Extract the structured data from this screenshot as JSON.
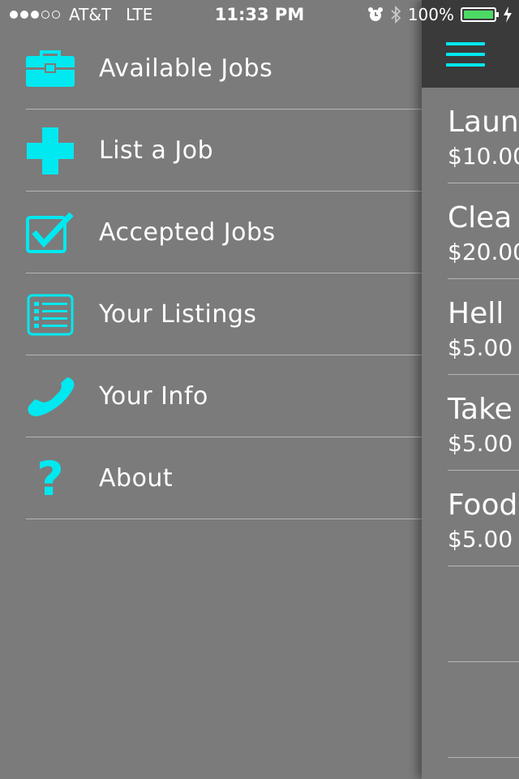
{
  "status_bar": {
    "carrier": "AT&T",
    "network": "LTE",
    "time": "11:33 PM",
    "battery_percent": "100%",
    "signal_bars": 3
  },
  "menu": {
    "items": [
      {
        "label": "Available Jobs",
        "icon": "briefcase-icon"
      },
      {
        "label": "List a Job",
        "icon": "plus-icon"
      },
      {
        "label": "Accepted Jobs",
        "icon": "checkbox-icon"
      },
      {
        "label": "Your Listings",
        "icon": "list-icon"
      },
      {
        "label": "Your Info",
        "icon": "phone-icon"
      },
      {
        "label": "About",
        "icon": "question-icon"
      }
    ]
  },
  "jobs": [
    {
      "title": "Laun",
      "price": "$10.00"
    },
    {
      "title": "Clea",
      "price": "$20.00"
    },
    {
      "title": "Hell",
      "price": "$5.00"
    },
    {
      "title": "Take",
      "price": "$5.00"
    },
    {
      "title": "Food",
      "price": "$5.00"
    }
  ],
  "colors": {
    "accent": "#00e8f0",
    "background": "#7b7b7b",
    "nav_bar": "#3a3a3a",
    "battery": "#4cd964"
  }
}
